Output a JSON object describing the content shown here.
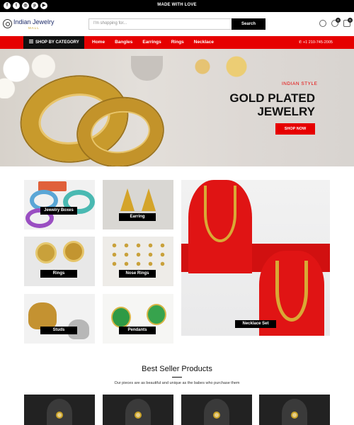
{
  "topbar": {
    "message": "MADE WITH LOVE",
    "social_icons": [
      "facebook-icon",
      "twitter-icon",
      "instagram-icon",
      "pinterest-icon",
      "youtube-icon"
    ]
  },
  "header": {
    "logo_name": "Indian Jewelry",
    "logo_sub": "MALL",
    "search_placeholder": "I'm shopping for...",
    "search_button": "Search",
    "wishlist_count": "0",
    "cart_count": "0"
  },
  "nav": {
    "category_label": "SHOP BY CATEGORY",
    "links": [
      "Home",
      "Bangles",
      "Earrings",
      "Rings",
      "Necklace"
    ],
    "phone": "+1 210-745-2005"
  },
  "hero": {
    "eyebrow": "INDIAN STYLE",
    "title_line1": "GOLD PLATED",
    "title_line2": "JEWELRY",
    "button": "SHOP NOW"
  },
  "categories": [
    {
      "label": "Jewelry Boxes"
    },
    {
      "label": "Earring"
    },
    {
      "label": "Rings"
    },
    {
      "label": "Nose Rings"
    },
    {
      "label": "Studs"
    },
    {
      "label": "Pendants"
    },
    {
      "label": "Necklace Set"
    }
  ],
  "best_sellers": {
    "title": "Best Seller Products",
    "subtitle": "Our pieces are as beautiful and unique as the babes who purchase them"
  },
  "colors": {
    "accent": "#e60000",
    "dark": "#000000",
    "gold": "#c89a2c"
  }
}
